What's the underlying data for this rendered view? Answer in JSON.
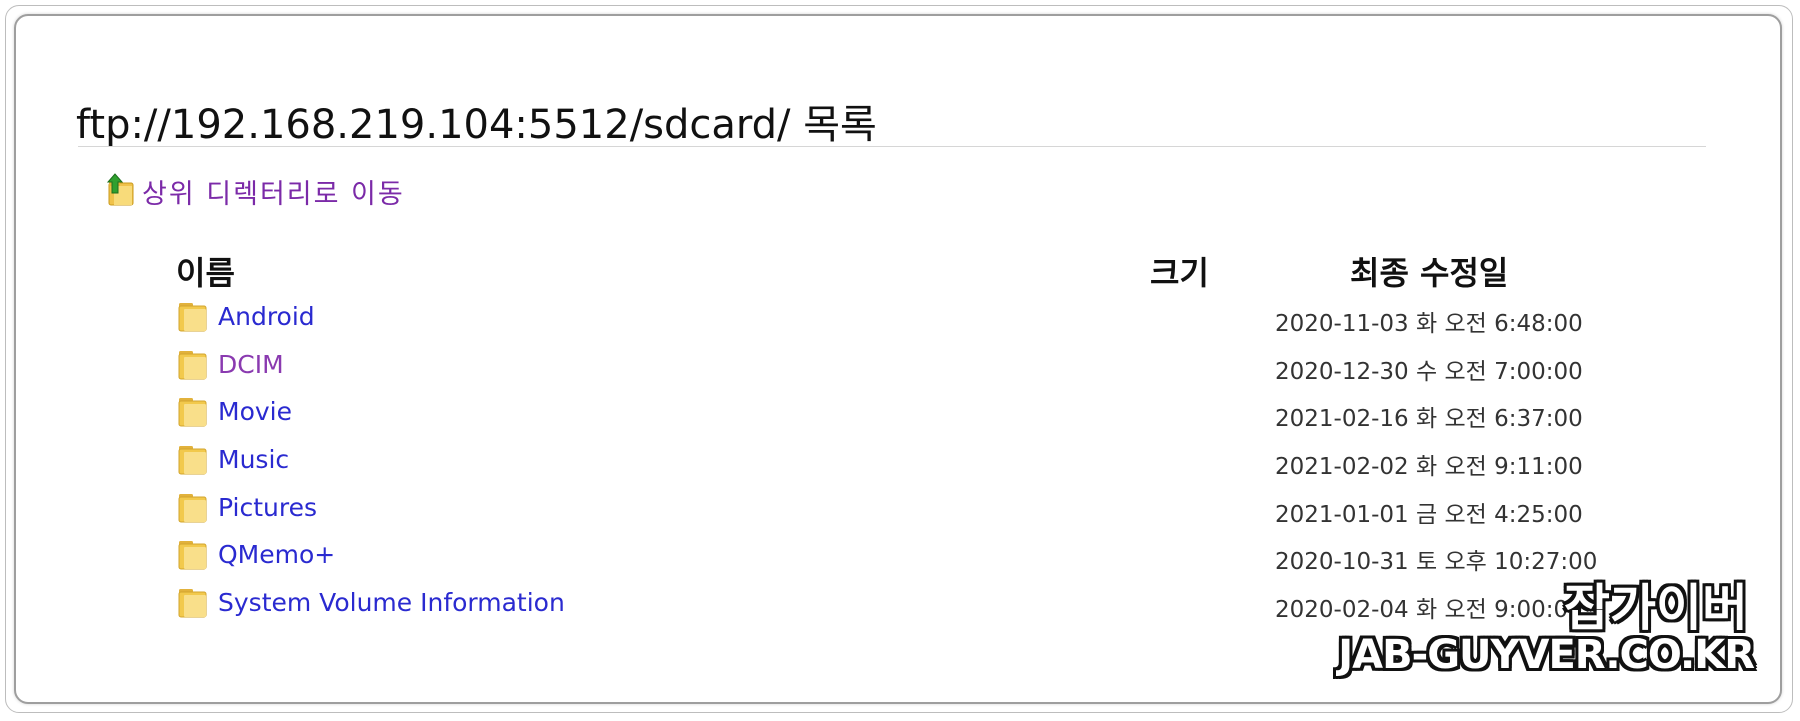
{
  "title": "ftp://192.168.219.104:5512/sdcard/ 목록",
  "up_link": {
    "label": "상위 디렉터리로 이동",
    "icon": "folder-up-icon"
  },
  "columns": {
    "name": "이름",
    "size": "크기",
    "modified": "최종 수정일"
  },
  "rows": [
    {
      "name": "Android",
      "size": "",
      "modified": "2020-11-03 화    오전 6:48:00",
      "visited": false
    },
    {
      "name": "DCIM",
      "size": "",
      "modified": "2020-12-30 수    오전 7:00:00",
      "visited": true
    },
    {
      "name": "Movie",
      "size": "",
      "modified": "2021-02-16 화    오전 6:37:00",
      "visited": false
    },
    {
      "name": "Music",
      "size": "",
      "modified": "2021-02-02 화    오전 9:11:00",
      "visited": false
    },
    {
      "name": "Pictures",
      "size": "",
      "modified": "2021-01-01 금    오전 4:25:00",
      "visited": false
    },
    {
      "name": "QMemo+",
      "size": "",
      "modified": "2020-10-31 토    오후 10:27:00",
      "visited": false
    },
    {
      "name": "System Volume Information",
      "size": "",
      "modified": "2020-02-04 화    오전 9:00:00",
      "visited": false
    }
  ],
  "watermark": {
    "korean": "잡가이버",
    "domain": "JAB-GUYVER.CO.KR"
  },
  "colors": {
    "link": "#2a2ad0",
    "visited_link": "#8a3ab0",
    "up_link": "#7b2aa8",
    "folder": "#f2c94c"
  }
}
